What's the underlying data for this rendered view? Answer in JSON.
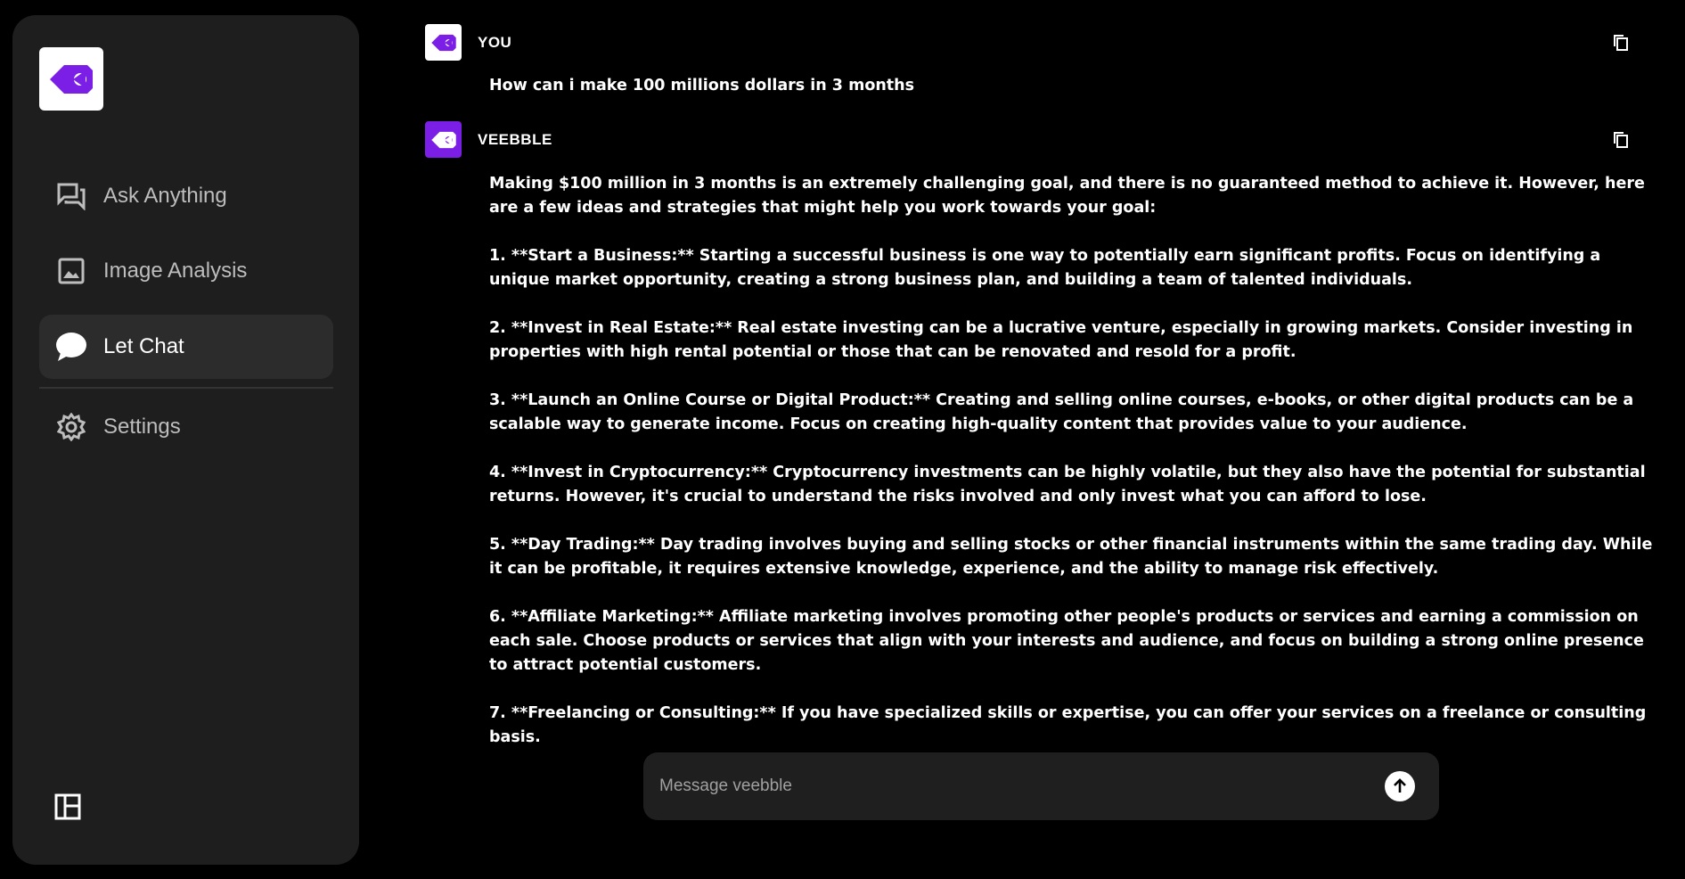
{
  "colors": {
    "brand": "#7c1fe6",
    "sidebar_bg": "#1e1e1e",
    "active_bg": "#2c2c2c",
    "composer_bg": "#1f1f1f"
  },
  "sidebar": {
    "logo_icon": "veebble-logo-icon",
    "items": [
      {
        "label": "Ask Anything",
        "icon": "forum-icon",
        "active": false
      },
      {
        "label": "Image Analysis",
        "icon": "image-icon",
        "active": false
      },
      {
        "label": "Let Chat",
        "icon": "chat-bubble-icon",
        "active": true
      },
      {
        "label": "Settings",
        "icon": "gear-icon",
        "active": false
      }
    ],
    "layout_toggle_icon": "layout-panel-icon"
  },
  "messages": [
    {
      "sender": "YOU",
      "text": "How can i make 100 millions dollars in 3 months"
    },
    {
      "sender": "VEEBBLE",
      "text": "Making $100 million in 3 months is an extremely challenging goal, and there is no guaranteed method to achieve it. However, here are a few ideas and strategies that might help you work towards your goal:\n\n1. **Start a Business:** Starting a successful business is one way to potentially earn significant profits. Focus on identifying a unique market opportunity, creating a strong business plan, and building a team of talented individuals.\n\n2. **Invest in Real Estate:** Real estate investing can be a lucrative venture, especially in growing markets. Consider investing in properties with high rental potential or those that can be renovated and resold for a profit.\n\n3. **Launch an Online Course or Digital Product:** Creating and selling online courses, e-books, or other digital products can be a scalable way to generate income. Focus on creating high-quality content that provides value to your audience.\n\n4. **Invest in Cryptocurrency:** Cryptocurrency investments can be highly volatile, but they also have the potential for substantial returns. However, it's crucial to understand the risks involved and only invest what you can afford to lose.\n\n5. **Day Trading:** Day trading involves buying and selling stocks or other financial instruments within the same trading day. While it can be profitable, it requires extensive knowledge, experience, and the ability to manage risk effectively.\n\n6. **Affiliate Marketing:** Affiliate marketing involves promoting other people's products or services and earning a commission on each sale. Choose products or services that align with your interests and audience, and focus on building a strong online presence to attract potential customers.\n\n7. **Freelancing or Consulting:** If you have specialized skills or expertise, you can offer your services on a freelance or consulting basis."
    }
  ],
  "composer": {
    "placeholder": "Message veebble",
    "value": "",
    "send_icon": "arrow-up-icon"
  }
}
